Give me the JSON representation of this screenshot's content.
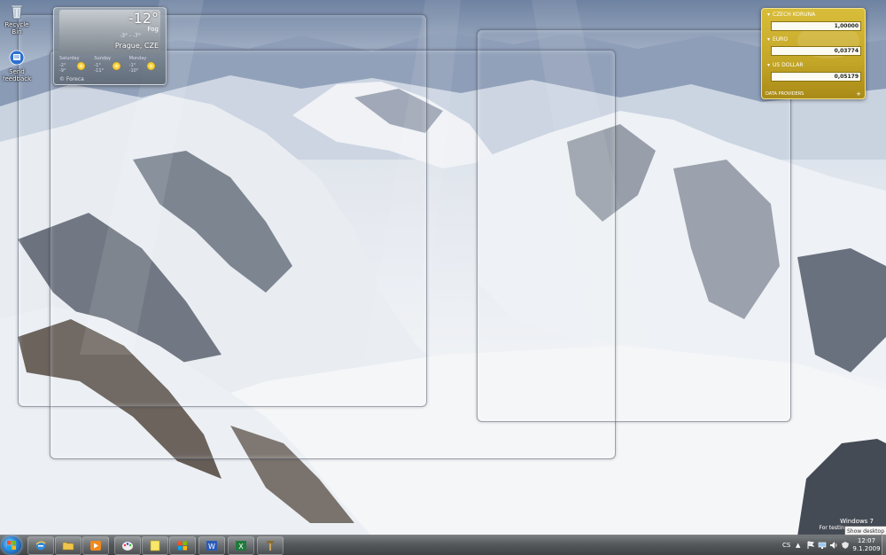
{
  "desktop": {
    "icons": [
      {
        "label": "Recycle Bin",
        "icon": "recycle-bin-icon"
      },
      {
        "label": "Send feedback",
        "icon": "feedback-icon"
      }
    ],
    "watermark": {
      "line1": "Windows 7",
      "line2": "For testing purposes"
    }
  },
  "weather": {
    "temperature": "-12°",
    "condition": "Fog",
    "range": "-3° - -7°",
    "city": "Prague, CZE",
    "forecast": [
      {
        "day": "Saturday",
        "hi": "-2°",
        "lo": "-9°",
        "icon": "sun-icon"
      },
      {
        "day": "Sunday",
        "hi": "-1°",
        "lo": "-11°",
        "icon": "sun-icon"
      },
      {
        "day": "Monday",
        "hi": "-1°",
        "lo": "-10°",
        "icon": "sun-icon"
      }
    ],
    "source": "© Foreca"
  },
  "currency": {
    "rows": [
      {
        "name": "CZECH KORUNA",
        "value": "1,00000"
      },
      {
        "name": "EURO",
        "value": "0,03774"
      },
      {
        "name": "US DOLLAR",
        "value": "0,05179"
      }
    ],
    "footer": "DATA PROVIDERS",
    "add": "+"
  },
  "tooltip": {
    "text": "Show desktop"
  },
  "taskbar": {
    "pinned": [
      {
        "name": "ie",
        "icon": "internet-explorer-icon"
      },
      {
        "name": "explorer",
        "icon": "folder-icon"
      },
      {
        "name": "media",
        "icon": "media-player-icon"
      },
      {
        "name": "paint",
        "icon": "paint-icon"
      },
      {
        "name": "notes",
        "icon": "sticky-notes-icon"
      },
      {
        "name": "windows",
        "icon": "windows-icon"
      },
      {
        "name": "word",
        "icon": "word-icon"
      },
      {
        "name": "excel",
        "icon": "excel-icon"
      },
      {
        "name": "tool",
        "icon": "tool-icon"
      }
    ],
    "language": "CS",
    "time": "12:07",
    "date": "9.1.2009"
  }
}
